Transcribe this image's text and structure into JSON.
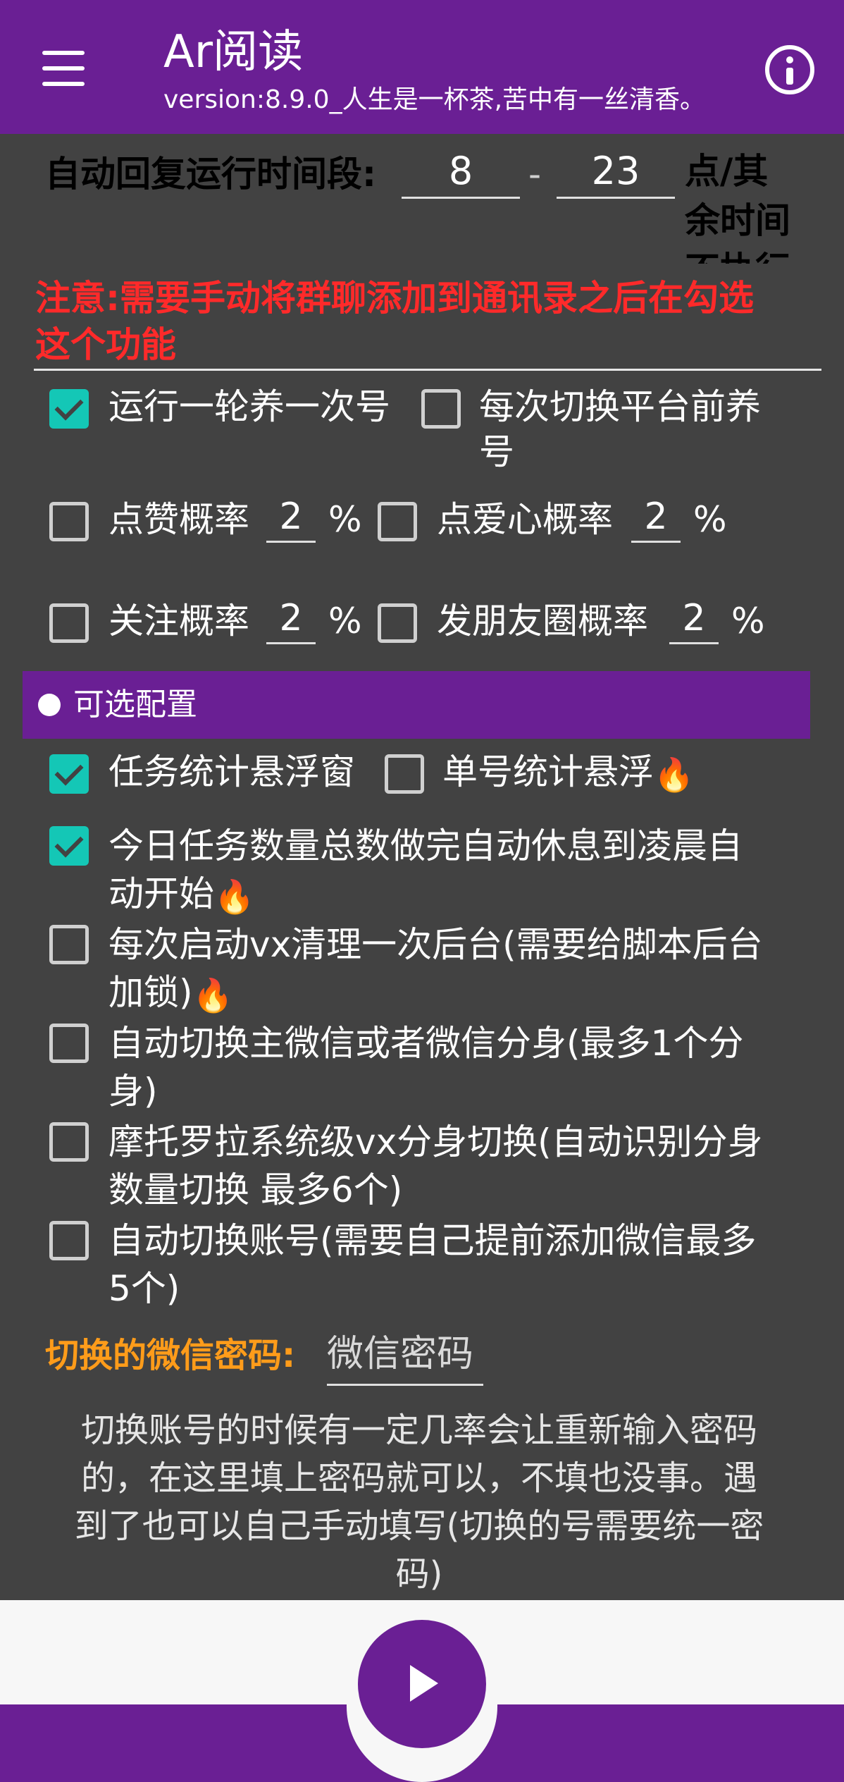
{
  "app": {
    "title": "Ar阅读",
    "subtitle": "version:8.9.0_人生是一杯茶,苦中有一丝清香。"
  },
  "icons": {
    "menu": "menu-icon",
    "info": "info-icon",
    "play": "play-icon",
    "fire": "fire-icon",
    "bullet": "bullet-icon"
  },
  "colors": {
    "primary": "#6a1f94",
    "background": "#424242",
    "checkbox_checked": "#14c7b6",
    "warning": "#ff2a2a",
    "accent_orange": "#ff9c1a"
  },
  "auto_reply": {
    "label": "自动回复运行时间段:",
    "start_hour": "8",
    "separator": "-",
    "end_hour": "23",
    "suffix_line1": "点/其",
    "suffix_line2": "余时间",
    "suffix_line3": "不执行"
  },
  "notice": {
    "line1": "注意:需要手动将群聊添加到通讯录之后在勾选",
    "line2": "这个功能"
  },
  "nurture": {
    "run_once": {
      "label": "运行一轮养一次号",
      "checked": true
    },
    "before_switch": {
      "label_line1": "每次切换平台前养",
      "label_line2": "号",
      "checked": false
    },
    "like": {
      "label": "点赞概率",
      "value": "2",
      "unit": "%",
      "checked": false
    },
    "love": {
      "label": "点爱心概率",
      "value": "2",
      "unit": "%",
      "checked": false
    },
    "follow": {
      "label": "关注概率",
      "value": "2",
      "unit": "%",
      "checked": false
    },
    "moments": {
      "label": "发朋友圈概率",
      "value": "2",
      "unit": "%",
      "checked": false
    }
  },
  "optional": {
    "header": "可选配置",
    "task_stats": {
      "label": "任务统计悬浮窗",
      "checked": true
    },
    "single_stats": {
      "label": "单号统计悬浮",
      "checked": false
    },
    "rest_after_done": {
      "line1": "今日任务数量总数做完自动休息到凌晨自",
      "line2": "动开始",
      "checked": true
    },
    "clean_background": {
      "line1": "每次启动vx清理一次后台(需要给脚本后台",
      "line2": "加锁)",
      "checked": false
    },
    "switch_clone": {
      "line1": "自动切换主微信或者微信分身(最多1个分",
      "line2": "身)",
      "checked": false
    },
    "motorola_clone": {
      "line1": "摩托罗拉系统级vx分身切换(自动识别分身",
      "line2": "数量切换 最多6个)",
      "checked": false
    },
    "switch_account": {
      "line1": "自动切换账号(需要自己提前添加微信最多",
      "line2": "5个)",
      "checked": false
    }
  },
  "password": {
    "label": "切换的微信密码:",
    "placeholder": "微信密码"
  },
  "hint": {
    "line1": "切换账号的时候有一定几率会让重新输入密码",
    "line2": "的，在这里填上密码就可以，不填也没事。遇",
    "line3": "到了也可以自己手动填写(切换的号需要统一密",
    "line4": "码)"
  }
}
